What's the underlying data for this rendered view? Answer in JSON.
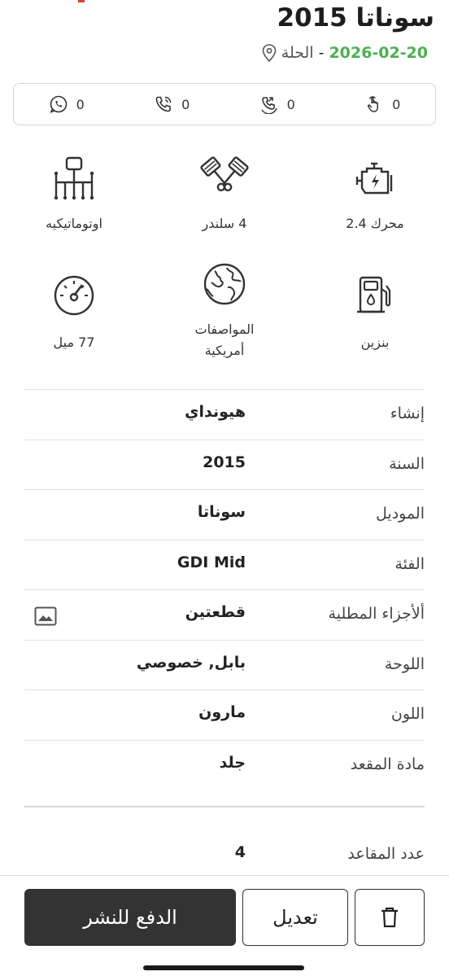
{
  "header": {
    "title": "سوناتا 2015",
    "city": "الحلة",
    "separator": "-",
    "date": "2026-02-20"
  },
  "stats": [
    {
      "icon": "whatsapp-icon",
      "count": "0"
    },
    {
      "icon": "phone-call-icon",
      "count": "0"
    },
    {
      "icon": "callback-icon",
      "count": "0"
    },
    {
      "icon": "tap-icon",
      "count": "0"
    }
  ],
  "specs": {
    "transmission": "اوتوماتيكيه",
    "cylinders": "4 سلندر",
    "engine": "محرك 2.4",
    "mileage": "77 ميل",
    "specification": "المواصفات أمريكية",
    "fuel": "بنزين"
  },
  "details": [
    {
      "key": "إنشاء",
      "value": "هيونداي"
    },
    {
      "key": "السنة",
      "value": "2015"
    },
    {
      "key": "الموديل",
      "value": "سوناتا"
    },
    {
      "key": "الفئة",
      "value": "GDI Mid"
    },
    {
      "key": "ألأجزاء المطلية",
      "value": "قطعتين"
    },
    {
      "key": "اللوحة",
      "value": "بابل, خصوصي"
    },
    {
      "key": "اللون",
      "value": "مارون"
    },
    {
      "key": "مادة المقعد",
      "value": "جلد"
    }
  ],
  "seats": {
    "key": "عدد المقاعد",
    "value": "4"
  },
  "actions": {
    "pay_label": "الدفع للنشر",
    "edit_label": "تعديل"
  },
  "colors": {
    "accent_green": "#4caf50",
    "dark_button": "#333333"
  }
}
